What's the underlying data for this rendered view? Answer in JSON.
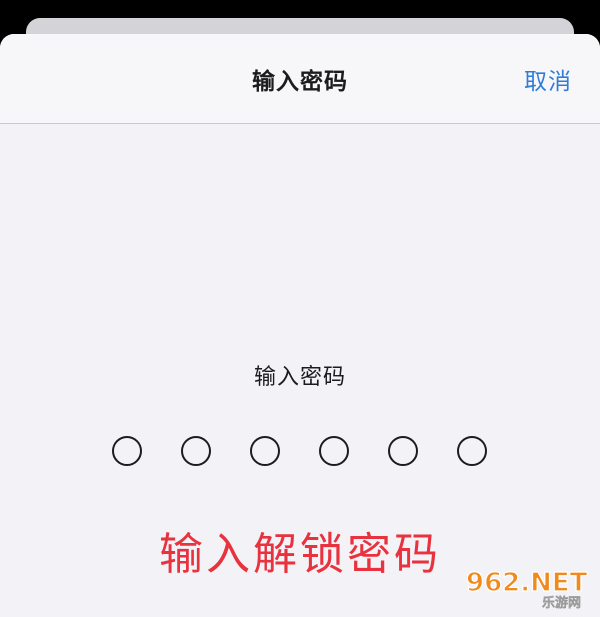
{
  "nav": {
    "title": "输入密码",
    "cancel_label": "取消"
  },
  "passcode": {
    "prompt": "输入密码",
    "length": 6,
    "entered": 0
  },
  "annotation": "输入解锁密码",
  "watermark": {
    "brand": "962.NET",
    "subtitle": "乐游网"
  },
  "colors": {
    "accent": "#2f7dd8",
    "annotation": "#e8323e",
    "sheet_background": "#f2f2f7",
    "nav_background": "#f7f7f9"
  }
}
